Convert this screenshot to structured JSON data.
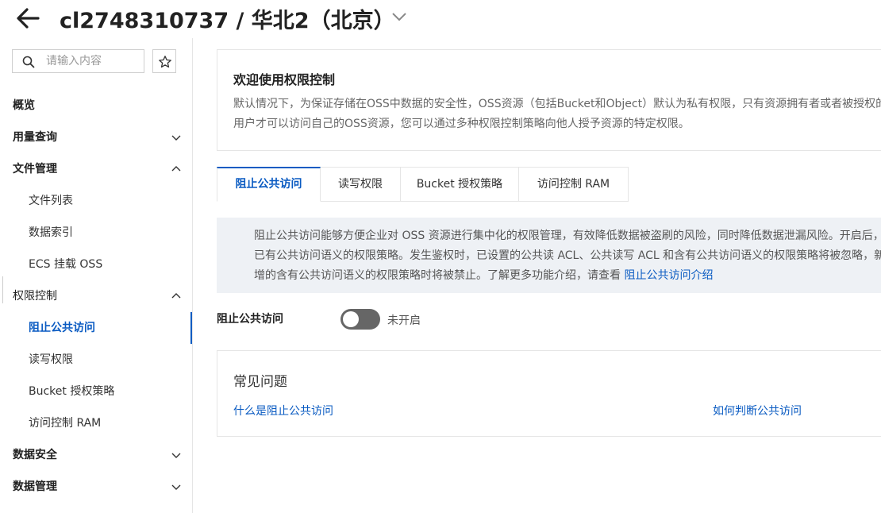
{
  "header": {
    "title": "cl2748310737 / 华北2（北京）"
  },
  "sidebar": {
    "search": {
      "placeholder": "请输入内容",
      "value": ""
    },
    "items": [
      {
        "label": "概览"
      },
      {
        "label": "用量查询"
      },
      {
        "label": "文件管理"
      },
      {
        "label": "文件列表"
      },
      {
        "label": "数据索引"
      },
      {
        "label": "ECS 挂载 OSS"
      },
      {
        "label": "权限控制"
      },
      {
        "label": "阻止公共访问"
      },
      {
        "label": "读写权限"
      },
      {
        "label": "Bucket 授权策略"
      },
      {
        "label": "访问控制 RAM"
      },
      {
        "label": "数据安全"
      },
      {
        "label": "数据管理"
      }
    ]
  },
  "welcome": {
    "title": "欢迎使用权限控制",
    "description": "默认情况下，为保证存储在OSS中数据的安全性，OSS资源（包括Bucket和Object）默认为私有权限，只有资源拥有者或者被授权的用户才可以访问自己的OSS资源，您可以通过多种权限控制策略向他人授予资源的特定权限。"
  },
  "tabs": [
    {
      "label": "阻止公共访问"
    },
    {
      "label": "读写权限"
    },
    {
      "label": "Bucket 授权策略"
    },
    {
      "label": "访问控制 RAM"
    }
  ],
  "notice": {
    "text": "阻止公共访问能够方便企业对 OSS 资源进行集中化的权限管理，有效降低数据被盗刷的风险，同时降低数据泄漏风险。开启后，已有公共访问语义的权限策略。发生鉴权时，已设置的公共读 ACL、公共读写 ACL 和含有公共访问语义的权限策略将被忽略，新增的含有公共访问语义的权限策略时将被禁止。了解更多功能介绍，请查看 ",
    "link": "阻止公共访问介绍"
  },
  "block_public_access": {
    "label": "阻止公共访问",
    "status": "未开启",
    "enabled": false
  },
  "faq": {
    "title": "常见问题",
    "links": [
      {
        "label": "什么是阻止公共访问"
      },
      {
        "label": "如何判断公共访问"
      }
    ]
  },
  "colors": {
    "accent": "#0a5bc2",
    "notice_bg": "#eef1f5",
    "toggle_off": "#666666"
  }
}
